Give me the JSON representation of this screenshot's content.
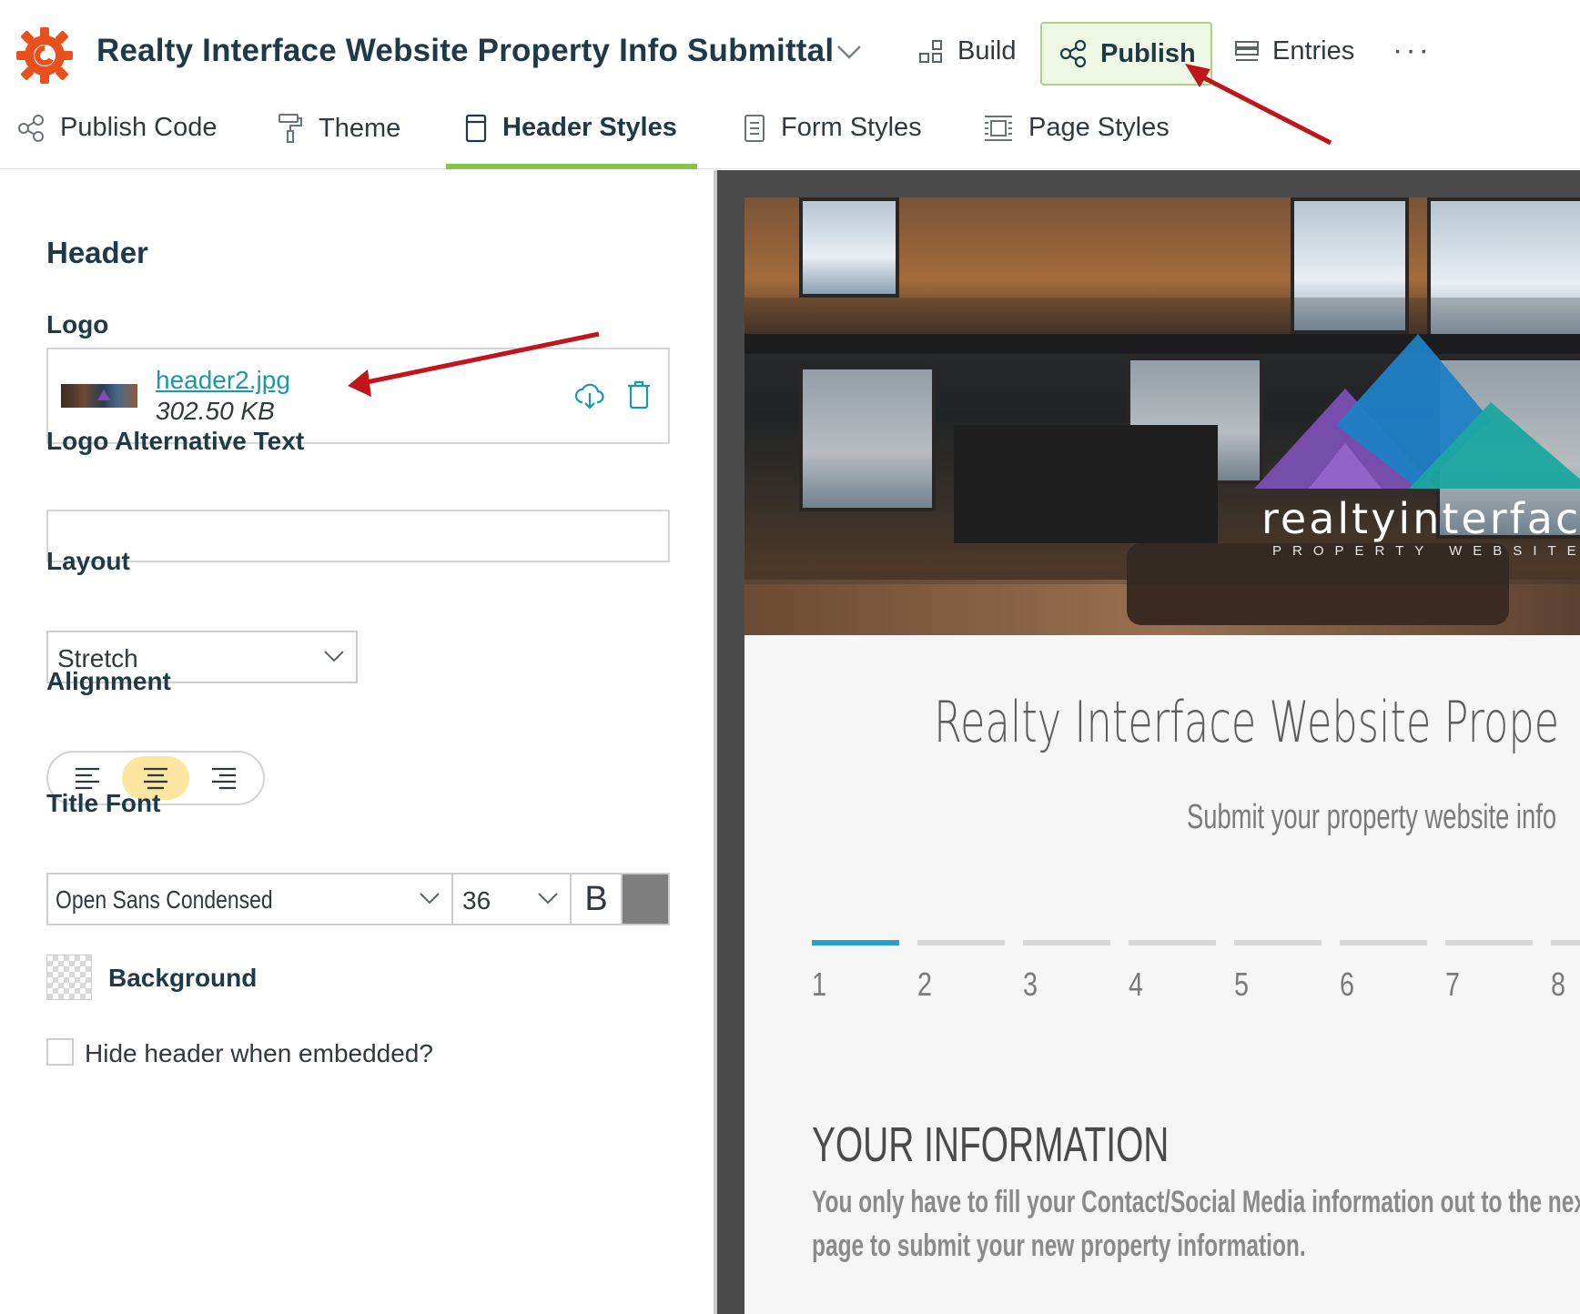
{
  "app": {
    "form_title": "Realty Interface Website Property Info Submittal",
    "brand_color": "#e8501e",
    "accent_color": "#8bc34a",
    "link_color": "#1a9aa8"
  },
  "topnav": {
    "build_label": "Build",
    "publish_label": "Publish",
    "entries_label": "Entries",
    "more_label": "···"
  },
  "tabs": [
    {
      "label": "Publish Code",
      "icon": "share-icon"
    },
    {
      "label": "Theme",
      "icon": "paint-roller-icon"
    },
    {
      "label": "Header Styles",
      "icon": "page-icon",
      "active": true
    },
    {
      "label": "Form Styles",
      "icon": "document-lines-icon"
    },
    {
      "label": "Page Styles",
      "icon": "page-layout-icon"
    }
  ],
  "panel": {
    "section_title": "Header",
    "logo_label": "Logo",
    "logo_file": {
      "name": "header2.jpg",
      "size": "302.50 KB"
    },
    "alt_text_label": "Logo Alternative Text",
    "alt_text_value": "",
    "layout_label": "Layout",
    "layout_value": "Stretch",
    "alignment_label": "Alignment",
    "alignment_selected": "center",
    "title_font_label": "Title Font",
    "title_font": {
      "family": "Open Sans Condensed",
      "size": "36",
      "bold_label": "B",
      "color": "#7f7f7f"
    },
    "background_label": "Background",
    "hide_header_label": "Hide header when embedded?",
    "hide_header_checked": false
  },
  "preview": {
    "brand_name": "realtyinterfac",
    "brand_sub": "PROPERTY WEBSITE",
    "title": "Realty Interface Website Prope",
    "subtitle": "Submit your property website info",
    "steps": [
      "1",
      "2",
      "3",
      "4",
      "5",
      "6",
      "7",
      "8"
    ],
    "active_step": 1,
    "info_heading": "YOUR INFORMATION",
    "info_text": "You only have to fill your Contact/Social Media information out to the next page to submit your new property information."
  }
}
